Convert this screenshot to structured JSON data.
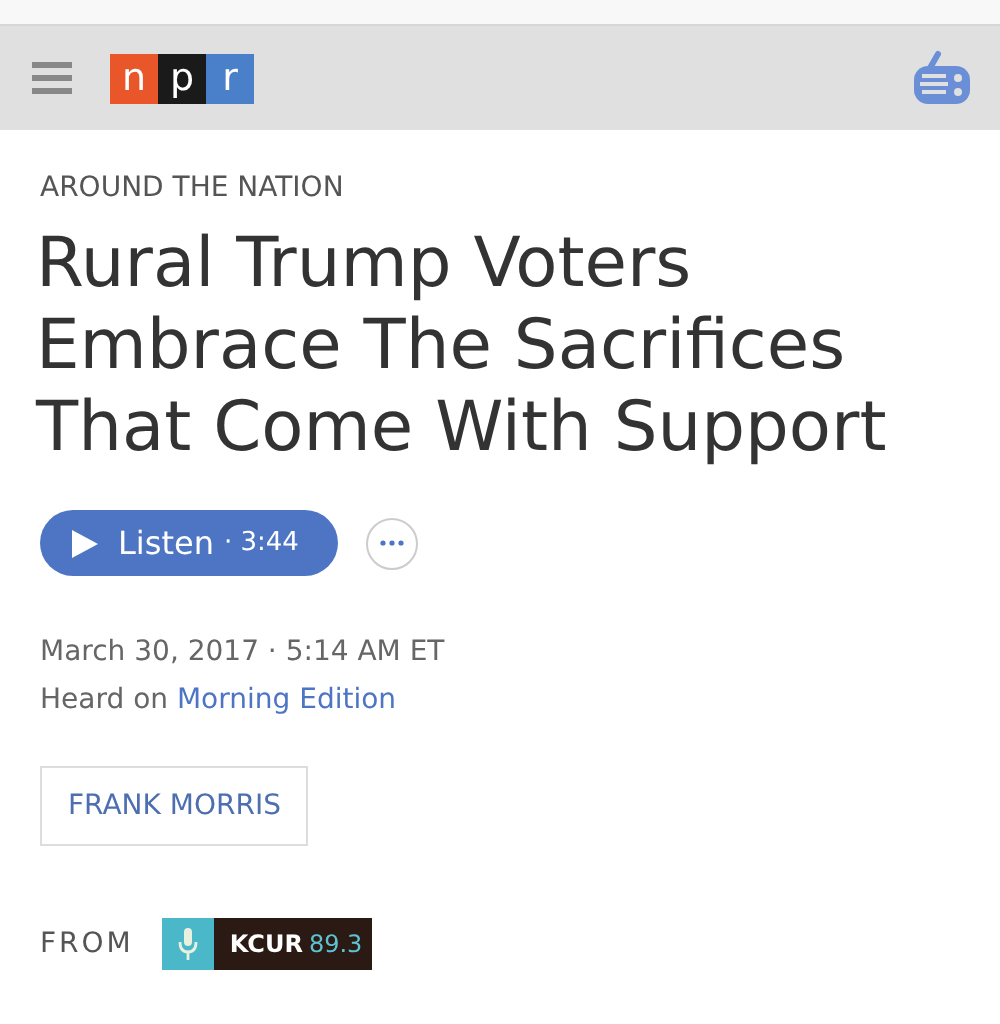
{
  "header": {
    "logo": [
      {
        "letter": "n",
        "color": "#e8562a"
      },
      {
        "letter": "p",
        "color": "#1a1a1a"
      },
      {
        "letter": "r",
        "color": "#4a7fc9"
      }
    ]
  },
  "article": {
    "section": "AROUND THE NATION",
    "title": "Rural Trump Voters Embrace The Sacrifices That Come With Support",
    "listen": {
      "label": "Listen",
      "separator": "·",
      "duration": "3:44"
    },
    "date": "March 30, 2017 · 5:14 AM ET",
    "heard_on": {
      "prefix": "Heard on",
      "program": "Morning Edition"
    },
    "byline": "FRANK MORRIS",
    "from": {
      "label": "FROM",
      "station": "KCUR",
      "frequency": "89.3"
    }
  }
}
